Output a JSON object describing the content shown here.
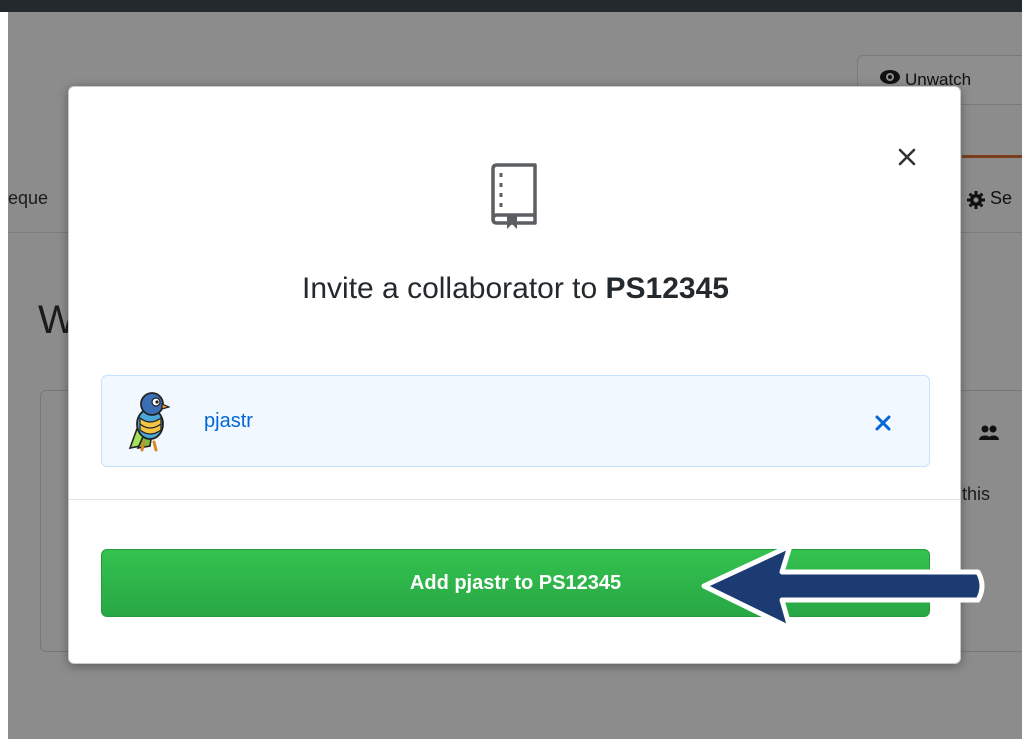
{
  "background": {
    "left_tab_fragment": "eque",
    "heading_fragment": "W",
    "watch_button_label": "Unwatch",
    "settings_tab_fragment": "Se",
    "paragraph_fragment": "this"
  },
  "modal": {
    "title_prefix": "Invite a collaborator to ",
    "repo_name": "PS12345",
    "selected_user": {
      "username": "pjastr"
    },
    "add_button_label": "Add pjastr to PS12345"
  },
  "colors": {
    "primary_green": "#28a745",
    "link_blue": "#0366d6",
    "annotation_arrow": "#1d3b73"
  },
  "icons": {
    "close": "close-icon",
    "repo": "repo-book-icon",
    "remove": "remove-x-icon",
    "watch": "eye-icon",
    "settings": "gear-icon",
    "people": "people-icon",
    "annotation": "arrow-left-icon"
  }
}
